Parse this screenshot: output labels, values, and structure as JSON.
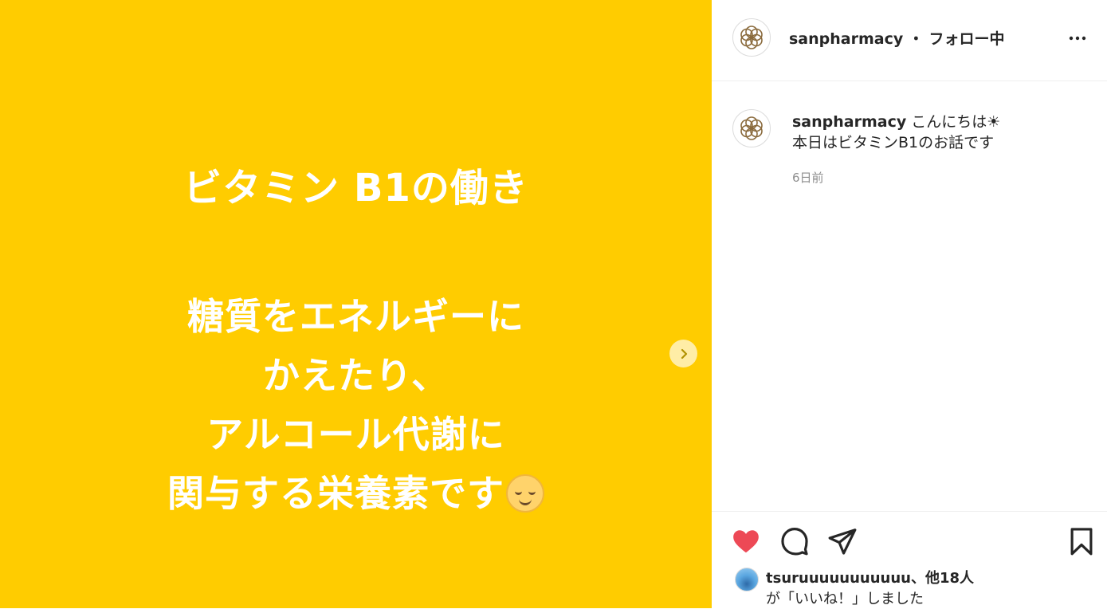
{
  "post": {
    "title": "ビタミン B1の働き",
    "lines": [
      "糖質をエネルギーに",
      "かえたり、",
      "アルコール代謝に",
      "関与する栄養素です"
    ],
    "emoji": "relieved-face-emoji"
  },
  "header": {
    "username": "sanpharmacy",
    "separator": "・",
    "follow_status": "フォロー中"
  },
  "caption": {
    "username": "sanpharmacy",
    "line1": "こんにちは☀",
    "line2": "本日はビタミンB1のお話です",
    "timestamp": "6日前"
  },
  "likes": {
    "user": "tsuruuuuuuuuuuu",
    "others": "、他18人",
    "suffix": "が「いいね！」しました"
  },
  "icons": {
    "like": "heart-icon-filled",
    "comment": "comment-icon",
    "share": "paper-plane-icon",
    "save": "bookmark-icon",
    "more": "more-options-icon",
    "next": "chevron-right-icon"
  },
  "colors": {
    "media_background": "#ffcc00",
    "like_red": "#ed4956",
    "logo_brown": "#8a6a3c"
  }
}
